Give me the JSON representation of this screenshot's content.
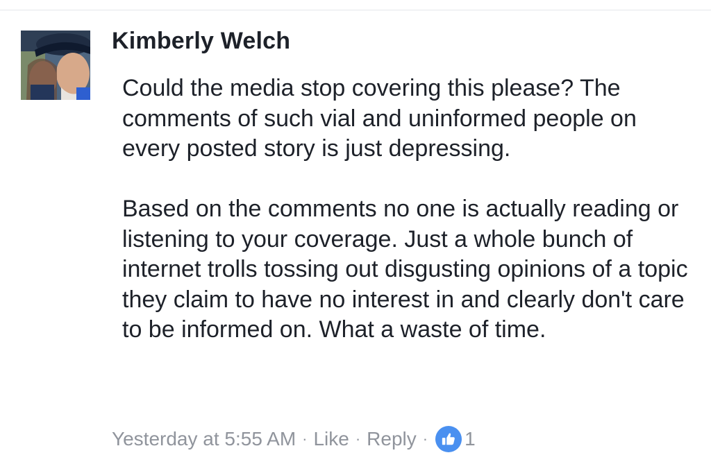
{
  "comment": {
    "author": "Kimberly Welch",
    "paragraphs": [
      "Could the media stop covering this please? The comments of such vial and uninformed people on every posted story is just depressing.",
      "Based on the comments no one is actually reading or listening to your coverage. Just a whole bunch of internet trolls tossing out disgusting opinions of a topic they claim to have no interest in and clearly don't care to be informed on. What a waste of time."
    ],
    "timestamp": "Yesterday at 5:55 AM",
    "separator": "·",
    "actions": {
      "like_label": "Like",
      "reply_label": "Reply"
    },
    "reaction": {
      "icon": "thumbs-up-icon",
      "count": "1",
      "color": "#4a90f0"
    }
  },
  "colors": {
    "text_primary": "#1d2129",
    "text_meta": "#90949c",
    "divider": "#e4e6ea"
  }
}
